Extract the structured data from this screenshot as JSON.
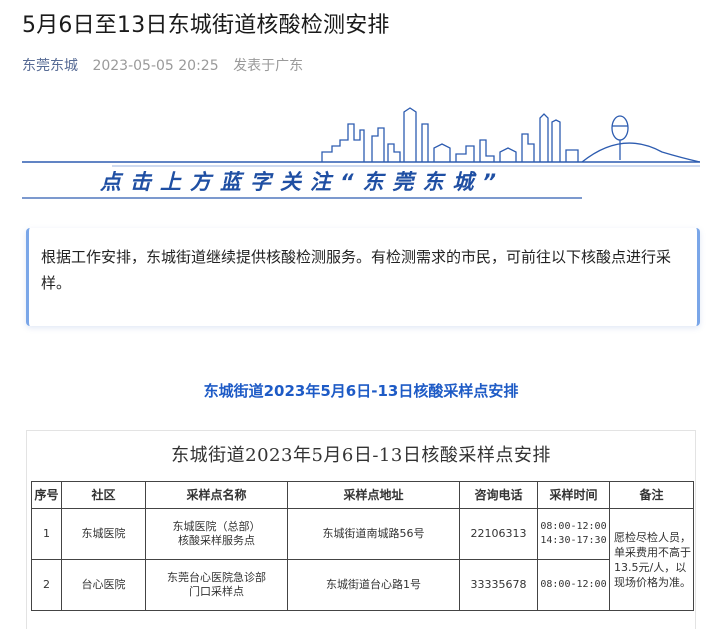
{
  "article": {
    "title": "5月6日至13日东城街道核酸检测安排",
    "author": "东莞东城",
    "date": "2023-05-05 20:25",
    "location": "发表于广东"
  },
  "banner": {
    "text": "点击上方蓝字关注“东莞东城”",
    "color": "#1f4fa3"
  },
  "notice": {
    "text": "根据工作安排，东城街道继续提供核酸检测服务。有检测需求的市民，可前往以下核酸点进行采样。"
  },
  "section_title": "东城街道2023年5月6日-13日核酸采样点安排",
  "table": {
    "heading": "东城街道2023年5月6日-13日核酸采样点安排",
    "columns": [
      "序号",
      "社区",
      "采样点名称",
      "采样点地址",
      "咨询电话",
      "采样时间",
      "备注"
    ],
    "rows": [
      {
        "index": "1",
        "community": "东城医院",
        "site": "东城医院（总部）\n核酸采样服务点",
        "address": "东城街道南城路56号",
        "phone": "22106313",
        "time": "08:00-12:00\n14:30-17:30"
      },
      {
        "index": "2",
        "community": "台心医院",
        "site": "东莞台心医院急诊部\n门口采样点",
        "address": "东城街道台心路1号",
        "phone": "33335678",
        "time": "08:00-12:00"
      }
    ],
    "note": "愿检尽检人员，单采费用不高于13.5元/人，以现场价格为准。"
  },
  "colors": {
    "accent": "#1e5bc6",
    "author": "#576b95",
    "notice_border": "#7aa6e8"
  }
}
